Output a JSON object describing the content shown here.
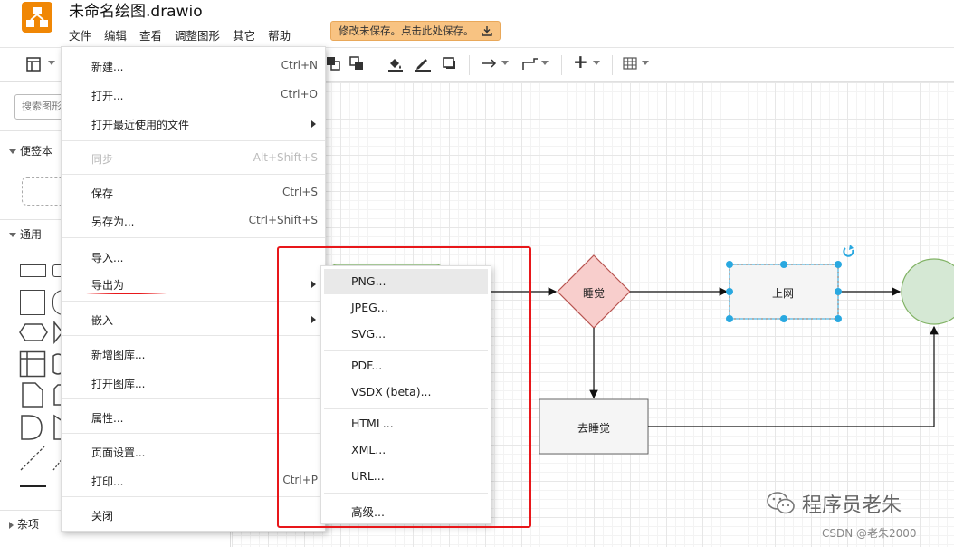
{
  "header": {
    "doc_title": "未命名绘图.drawio",
    "menus": [
      "文件",
      "编辑",
      "查看",
      "调整图形",
      "其它",
      "帮助"
    ],
    "save_banner": "修改未保存。点击此处保存。"
  },
  "sidebar": {
    "search_placeholder": "搜索图形",
    "sections": {
      "scratchpad": "便签本",
      "general": "通用",
      "misc": "杂项"
    }
  },
  "file_menu": {
    "items": [
      {
        "label": "新建...",
        "shortcut": "Ctrl+N"
      },
      {
        "label": "打开...",
        "shortcut": "Ctrl+O"
      },
      {
        "label": "打开最近使用的文件",
        "shortcut": ""
      },
      {
        "label": "同步",
        "shortcut": "Alt+Shift+S"
      },
      {
        "label": "保存",
        "shortcut": "Ctrl+S"
      },
      {
        "label": "另存为...",
        "shortcut": "Ctrl+Shift+S"
      },
      {
        "label": "导入...",
        "shortcut": ""
      },
      {
        "label": "导出为",
        "shortcut": ""
      },
      {
        "label": "嵌入",
        "shortcut": ""
      },
      {
        "label": "新增图库...",
        "shortcut": ""
      },
      {
        "label": "打开图库...",
        "shortcut": ""
      },
      {
        "label": "属性...",
        "shortcut": ""
      },
      {
        "label": "页面设置...",
        "shortcut": ""
      },
      {
        "label": "打印...",
        "shortcut": "Ctrl+P"
      },
      {
        "label": "关闭",
        "shortcut": ""
      }
    ]
  },
  "export_menu": {
    "items": [
      "PNG...",
      "JPEG...",
      "SVG...",
      "PDF...",
      "VSDX (beta)...",
      "HTML...",
      "XML...",
      "URL...",
      "高级..."
    ],
    "highlighted": "PNG..."
  },
  "diagram": {
    "nodes": {
      "decision": "睡觉",
      "selected": "上网",
      "process": "去睡觉"
    },
    "colors": {
      "decision_fill": "#f8cecc",
      "decision_stroke": "#b85450",
      "circle_fill": "#d5e8d4",
      "circle_stroke": "#82b366",
      "selection": "#29a8e0"
    }
  },
  "watermark": {
    "text": "程序员老朱",
    "credit": "CSDN @老朱2000"
  },
  "colors": {
    "accent_orange": "#f08705",
    "banner": "#f8c382",
    "highlight_red": "#e8171a"
  }
}
